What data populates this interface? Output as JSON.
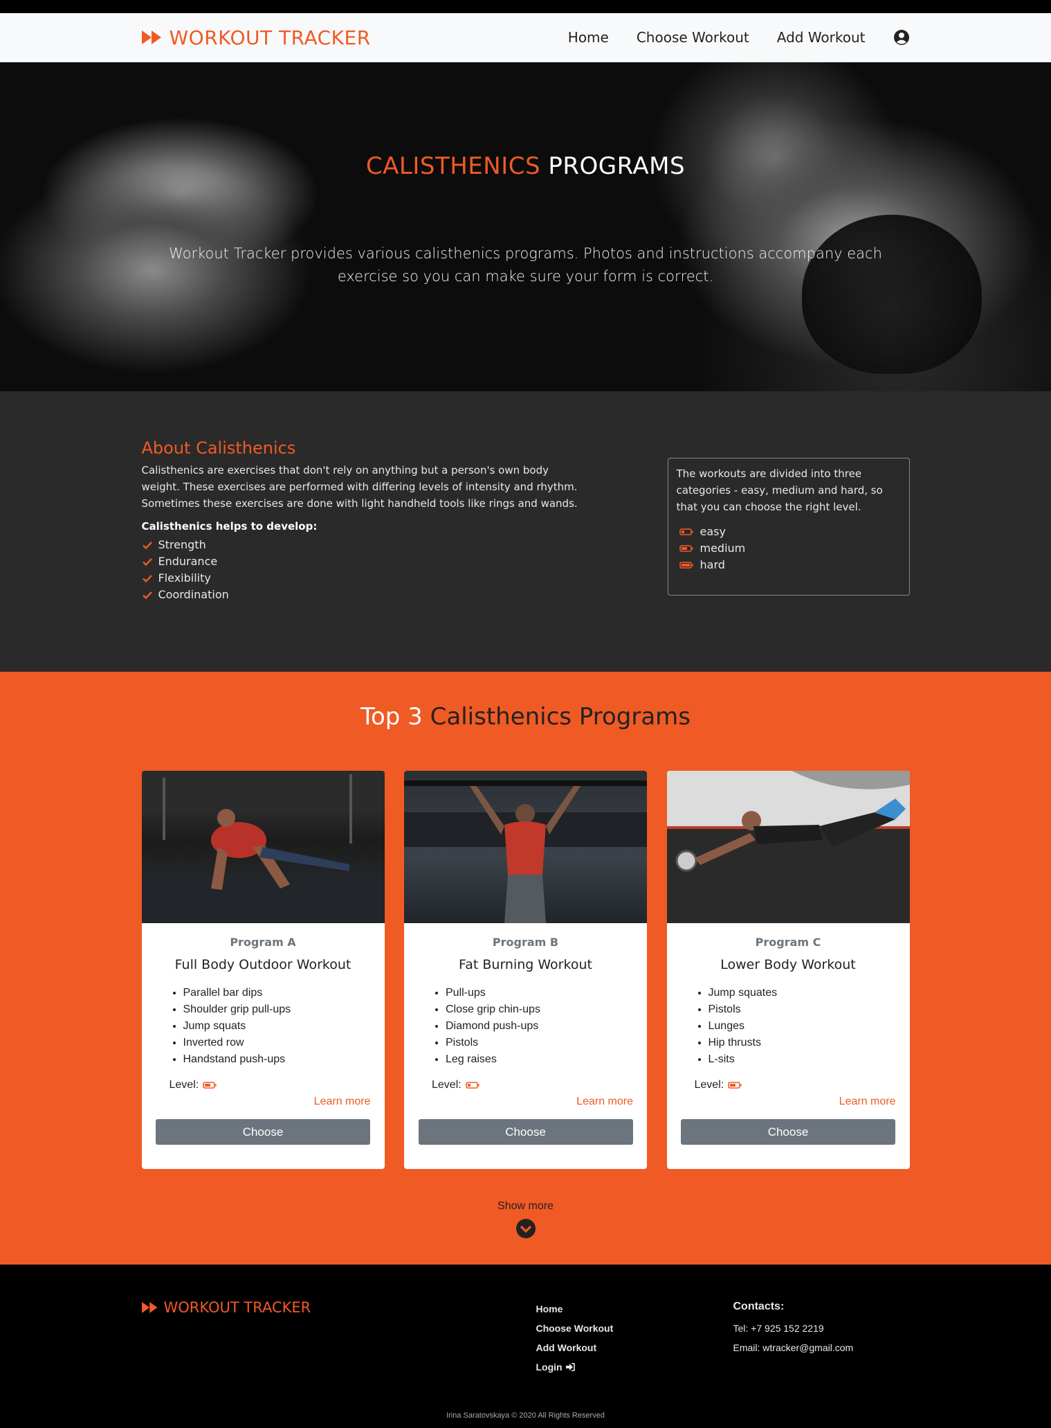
{
  "brand": {
    "name": "WORKOUT TRACKER",
    "logo_icon": "fast-forward-icon",
    "accent": "#f15a24"
  },
  "nav": {
    "links": [
      "Home",
      "Choose Workout",
      "Add Workout"
    ],
    "user_icon": "user-circle-icon"
  },
  "hero": {
    "title_accent": "CALISTHENICS",
    "title_rest": "PROGRAMS",
    "text": "Workout Tracker provides various calisthenics programs. Photos and instructions accompany each exercise so you can make sure your form is correct."
  },
  "about": {
    "title": "About Calisthenics",
    "text": "Calisthenics are exercises that don't rely on anything but a person's own body weight. These exercises are performed with differing levels of intensity and rhythm. Sometimes these exercises are done with light handheld tools like rings and wands.",
    "develop_title": "Calisthenics helps to develop:",
    "develop": [
      "Strength",
      "Endurance",
      "Flexibility",
      "Coordination"
    ],
    "levels_text": "The workouts are divided into three categories - easy, medium and hard, so that you can choose the right level.",
    "levels": [
      "easy",
      "medium",
      "hard"
    ]
  },
  "programs": {
    "title_white": "Top 3",
    "title_rest": "Calisthenics Programs",
    "cards": [
      {
        "program": "Program A",
        "name": "Full Body Outdoor Workout",
        "exercises": [
          "Parallel bar dips",
          "Shoulder grip pull-ups",
          "Jump squats",
          "Inverted row",
          "Handstand push-ups"
        ],
        "level_label": "Level:",
        "level": "medium",
        "learn_more": "Learn more",
        "button": "Choose"
      },
      {
        "program": "Program B",
        "name": "Fat Burning Workout",
        "exercises": [
          "Pull-ups",
          "Close grip chin-ups",
          "Diamond push-ups",
          "Pistols",
          "Leg raises"
        ],
        "level_label": "Level:",
        "level": "easy",
        "learn_more": "Learn more",
        "button": "Choose"
      },
      {
        "program": "Program C",
        "name": "Lower Body Workout",
        "exercises": [
          "Jump squates",
          "Pistols",
          "Lunges",
          "Hip thrusts",
          "L-sits"
        ],
        "level_label": "Level:",
        "level": "medium",
        "learn_more": "Learn more",
        "button": "Choose"
      }
    ],
    "show_more": "Show more",
    "show_more_icon": "chevron-down-circle-icon"
  },
  "footer": {
    "brand": "WORKOUT TRACKER",
    "links": [
      "Home",
      "Choose Workout",
      "Add Workout",
      "Login"
    ],
    "login_icon": "sign-in-icon",
    "contacts_title": "Contacts:",
    "tel": "Tel: +7 925 152 2219",
    "email": "Email: wtracker@gmail.com",
    "copyright": "Irina Saratovskaya © 2020 All Rights Reserved"
  }
}
